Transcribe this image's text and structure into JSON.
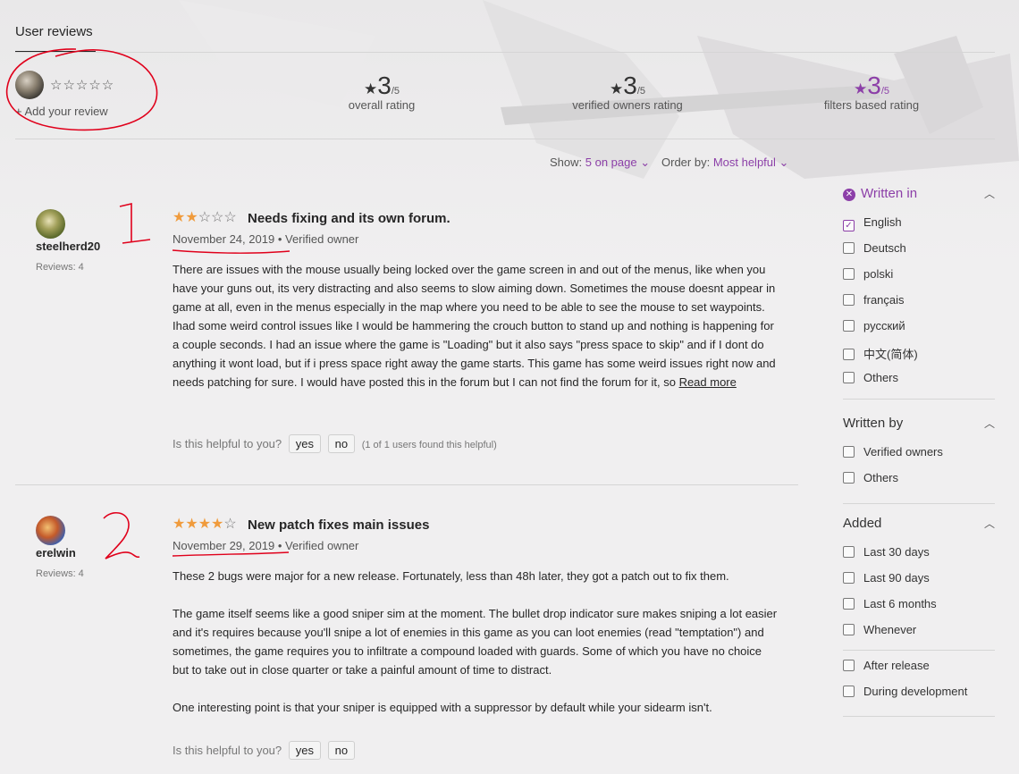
{
  "section_title": "User reviews",
  "my_review": {
    "stars": "☆☆☆☆☆",
    "add_label": "+ Add your review"
  },
  "ratings": [
    {
      "value": "3",
      "denominator": "/5",
      "caption": "overall rating"
    },
    {
      "value": "3",
      "denominator": "/5",
      "caption": "verified owners rating"
    },
    {
      "value": "3",
      "denominator": "/5",
      "caption": "filters based rating"
    }
  ],
  "toolbar": {
    "show_label": "Show:",
    "show_value": "5 on page",
    "order_label": "Order by:",
    "order_value": "Most helpful"
  },
  "reviews": [
    {
      "username": "steelherd20",
      "reviews_count": "Reviews: 4",
      "stars_on": "★★",
      "stars_off": "☆☆☆",
      "rating": 2,
      "title": "Needs fixing and its own forum.",
      "date": "November 24, 2019",
      "owner_badge": "Verified owner",
      "body": "There are issues with the mouse usually being locked over the game screen in and out of the menus, like when you have your guns out, its very distracting and also seems to slow aiming down. Sometimes the mouse doesnt appear in game at all, even in the menus especially in the map where you need to be able to see the mouse to set waypoints. Ihad some weird control issues like I would be hammering the crouch button to stand up and nothing is happening for a couple seconds. I had an issue where the game is \"Loading\" but it also says \"press space to skip\" and if I dont do anything it wont load, but if i press space right away the game starts. This game has some weird issues right now and needs patching for sure. I would have posted this in the forum but I can not find the forum for it, so",
      "read_more": "Read more",
      "helpful_q": "Is this helpful to you?",
      "yes": "yes",
      "no": "no",
      "helpful_note": "(1 of 1 users found this helpful)"
    },
    {
      "username": "erelwin",
      "reviews_count": "Reviews: 4",
      "stars_on": "★★★★",
      "stars_off": "☆",
      "rating": 4,
      "title": "New patch fixes main issues",
      "date": "November 29, 2019",
      "owner_badge": "Verified owner",
      "p1": "These 2 bugs were major for a new release. Fortunately, less than 48h later, they got a patch out to fix them.",
      "p2": "The game itself seems like a good sniper sim at the moment. The bullet drop indicator sure makes sniping a lot easier and it's requires because you'll snipe a lot of enemies in this game as you can loot enemies (read \"temptation\") and sometimes, the game requires you to infiltrate a compound loaded with guards. Some of which you have no choice but to take out in close quarter or take a painful amount of time to distract.",
      "p3": "One interesting point is that your sniper is equipped with a suppressor by default while your sidearm isn't.",
      "helpful_q": "Is this helpful to you?",
      "yes": "yes",
      "no": "no"
    }
  ],
  "filters": {
    "written_in": {
      "title": "Written in",
      "options": [
        "English",
        "Deutsch",
        "polski",
        "français",
        "русский",
        "中文(简体)",
        "Others"
      ]
    },
    "written_by": {
      "title": "Written by",
      "options": [
        "Verified owners",
        "Others"
      ]
    },
    "added": {
      "title": "Added",
      "options": [
        "Last 30 days",
        "Last 90 days",
        "Last 6 months",
        "Whenever"
      ],
      "options2": [
        "After release",
        "During development"
      ]
    }
  },
  "colors": {
    "accent": "#8c3fa8",
    "star": "#f09b3c",
    "annotation": "#e0001b"
  },
  "annotations": {
    "mark_1": "1",
    "mark_2": "2"
  }
}
